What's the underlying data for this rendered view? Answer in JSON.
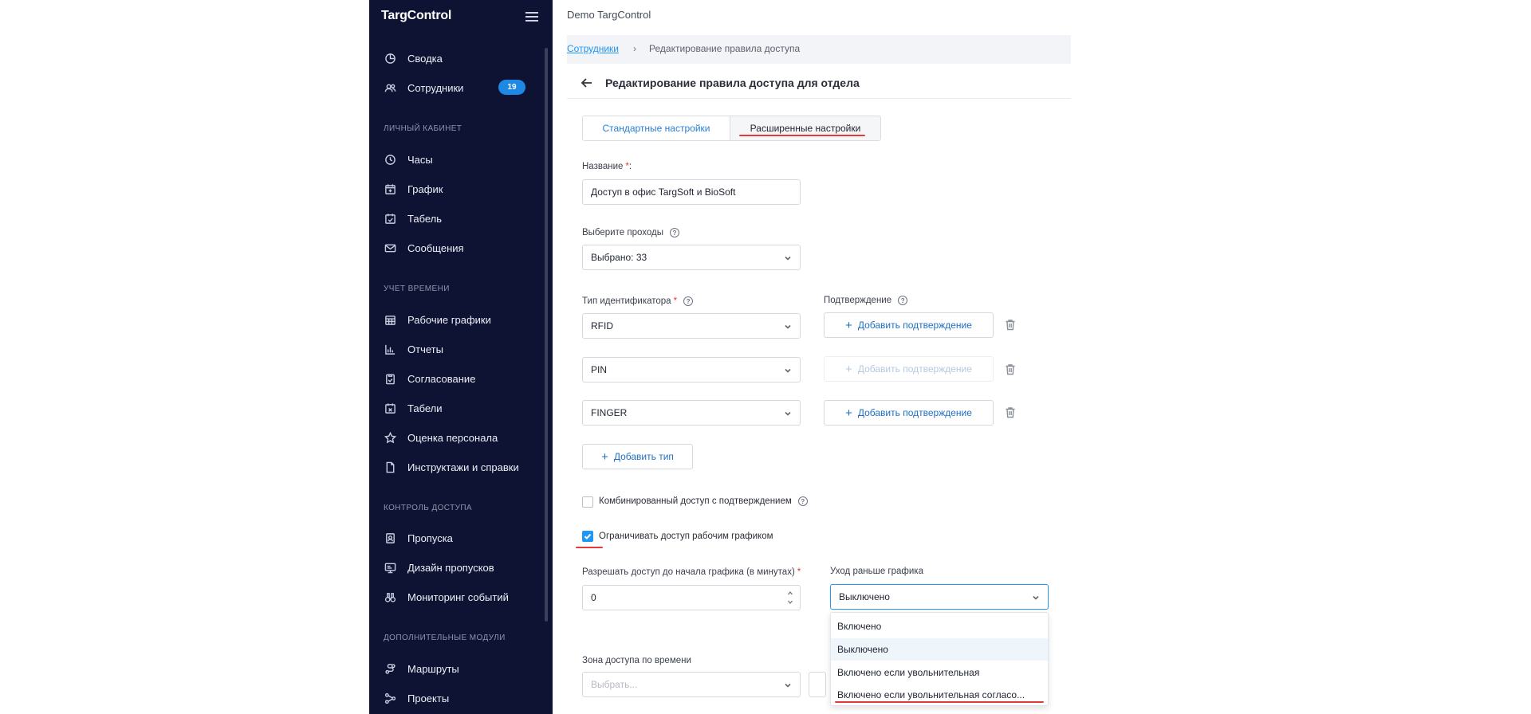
{
  "sidebar": {
    "logo": "TargControl",
    "items": [
      {
        "label": "Сводка",
        "icon": "pie-chart-icon"
      },
      {
        "label": "Сотрудники",
        "icon": "users-icon",
        "badge": "19"
      },
      {
        "label": "Часы",
        "icon": "clock-icon"
      },
      {
        "label": "График",
        "icon": "calendar-plus-icon"
      },
      {
        "label": "Табель",
        "icon": "calendar-check-icon"
      },
      {
        "label": "Сообщения",
        "icon": "mail-icon"
      },
      {
        "label": "Рабочие графики",
        "icon": "calendar-grid-icon"
      },
      {
        "label": "Отчеты",
        "icon": "bar-chart-icon"
      },
      {
        "label": "Согласование",
        "icon": "clipboard-check-icon"
      },
      {
        "label": "Табели",
        "icon": "calendar-x-icon"
      },
      {
        "label": "Оценка персонала",
        "icon": "star-icon"
      },
      {
        "label": "Инструктажи и справки",
        "icon": "document-icon"
      },
      {
        "label": "Пропуска",
        "icon": "badge-icon"
      },
      {
        "label": "Дизайн пропусков",
        "icon": "design-icon"
      },
      {
        "label": "Мониторинг событий",
        "icon": "binoculars-icon"
      },
      {
        "label": "Маршруты",
        "icon": "route-icon"
      },
      {
        "label": "Проекты",
        "icon": "projects-icon"
      }
    ],
    "sections": [
      "ЛИЧНЫЙ КАБИНЕТ",
      "УЧЕТ ВРЕМЕНИ",
      "КОНТРОЛЬ ДОСТУПА",
      "ДОПОЛНИТЕЛЬНЫЕ МОДУЛИ"
    ]
  },
  "header": {
    "app_title": "Demo TargControl"
  },
  "breadcrumb": {
    "link": "Сотрудники",
    "sep": "›",
    "current": "Редактирование правила доступа"
  },
  "page": {
    "title": "Редактирование правила доступа для отдела"
  },
  "tabs": [
    {
      "label": "Стандартные настройки"
    },
    {
      "label": "Расширенные настройки"
    }
  ],
  "form": {
    "name_label": "Название",
    "required_mark": "*",
    "name_colon": ":",
    "name_value": "Доступ в офис TargSoft и BioSoft",
    "passes_label": "Выберите проходы",
    "passes_value": "Выбрано: 33",
    "id_type_label": "Тип идентификатора",
    "confirm_label": "Подтверждение",
    "id_rows": [
      {
        "type": "RFID",
        "confirm": "Добавить подтверждение",
        "enabled": true
      },
      {
        "type": "PIN",
        "confirm": "Добавить подтверждение",
        "enabled": false
      },
      {
        "type": "FINGER",
        "confirm": "Добавить подтверждение",
        "enabled": true
      }
    ],
    "add_type": "Добавить тип",
    "plus": "+",
    "help": "?",
    "combined_label": "Комбинированный доступ с подтверждением",
    "combined_checked": false,
    "restrict_label": "Ограничивать доступ рабочим графиком",
    "restrict_checked": true,
    "before_label": "Разрешать доступ до начала графика (в минутах)",
    "before_value": "0",
    "early_label": "Уход раньше графика",
    "early_value": "Выключено",
    "zone_label": "Зона доступа по времени",
    "zone_placeholder": "Выбрать..."
  },
  "dropdown": {
    "options": [
      "Включено",
      "Выключено",
      "Включено если увольнительная",
      "Включено если увольнительная согласо..."
    ],
    "selected": "Выключено"
  },
  "colors": {
    "sidebar_bg": "#0e1333",
    "accent": "#2196f3",
    "highlight_underline": "#e5393a"
  }
}
